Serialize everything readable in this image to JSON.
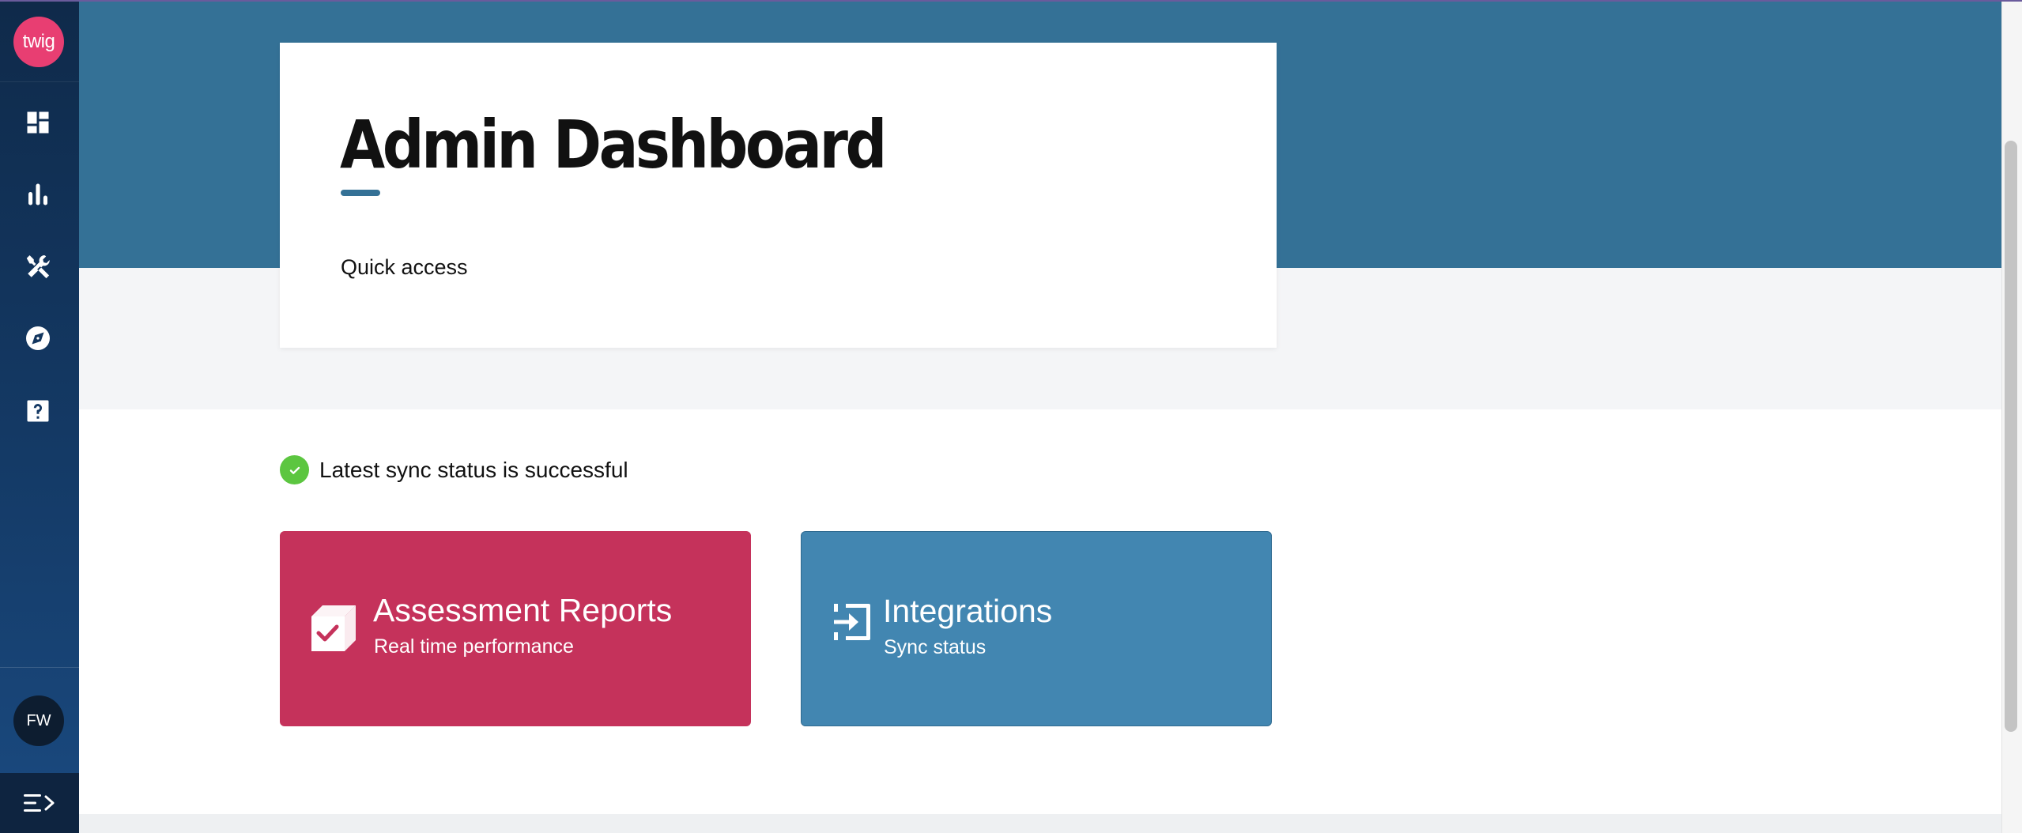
{
  "sidebar": {
    "logo_text": "twig",
    "nav_icons": [
      "dashboard-icon",
      "bar-chart-icon",
      "tools-icon",
      "compass-icon",
      "help-icon"
    ],
    "avatar_initials": "FW",
    "toggle_icon": "menu-expand-icon"
  },
  "header": {
    "title": "Admin Dashboard",
    "quick_access": "Quick access"
  },
  "sync": {
    "status_text": "Latest sync status is successful",
    "status_color": "#5cc640"
  },
  "tiles": [
    {
      "title": "Assessment Reports",
      "subtitle": "Real time performance",
      "color": "#c5325b",
      "icon": "box-check-icon"
    },
    {
      "title": "Integrations",
      "subtitle": "Sync status",
      "color": "#4286b1",
      "icon": "import-icon"
    }
  ],
  "colors": {
    "hero": "#347196",
    "sidebar": "#143a66",
    "logo": "#e83e72"
  }
}
